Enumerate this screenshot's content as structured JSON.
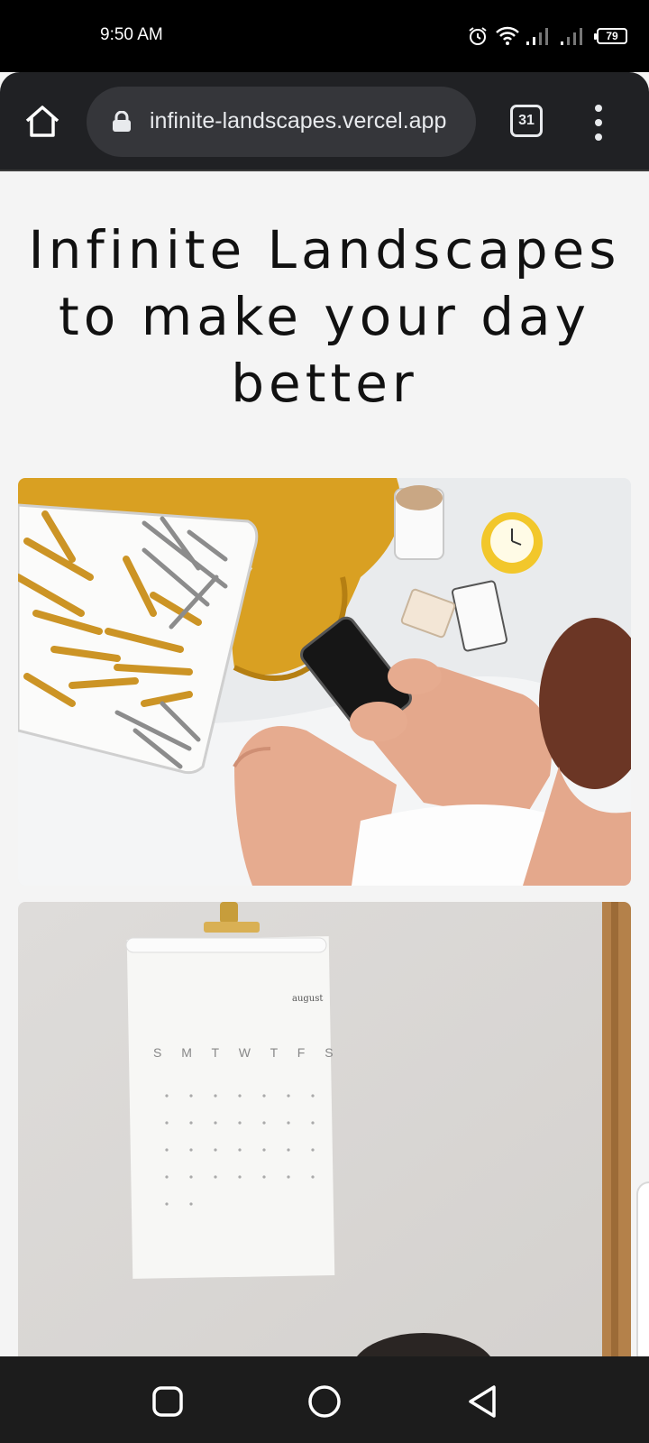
{
  "status_bar": {
    "time": "9:50 AM",
    "battery": "79"
  },
  "browser": {
    "url": "infinite-landscapes.vercel.app",
    "tab_count": "31"
  },
  "page": {
    "title": "Infinite Landscapes to make your day better",
    "images": [
      {
        "name": "bedroom-phone-photo"
      },
      {
        "name": "wall-calendar-photo",
        "calendar_weekdays": "S M T W T F S"
      }
    ]
  },
  "colors": {
    "toolbar": "#202124",
    "urlbar": "#35363a",
    "page_bg": "#f4f4f4",
    "mustard": "#d9a022"
  },
  "icons": [
    "home-icon",
    "lock-icon",
    "tabs-icon",
    "overflow-menu-icon",
    "alarm-icon",
    "wifi-icon",
    "signal-icon",
    "battery-icon",
    "recents-icon",
    "home-circle-icon",
    "back-icon"
  ]
}
